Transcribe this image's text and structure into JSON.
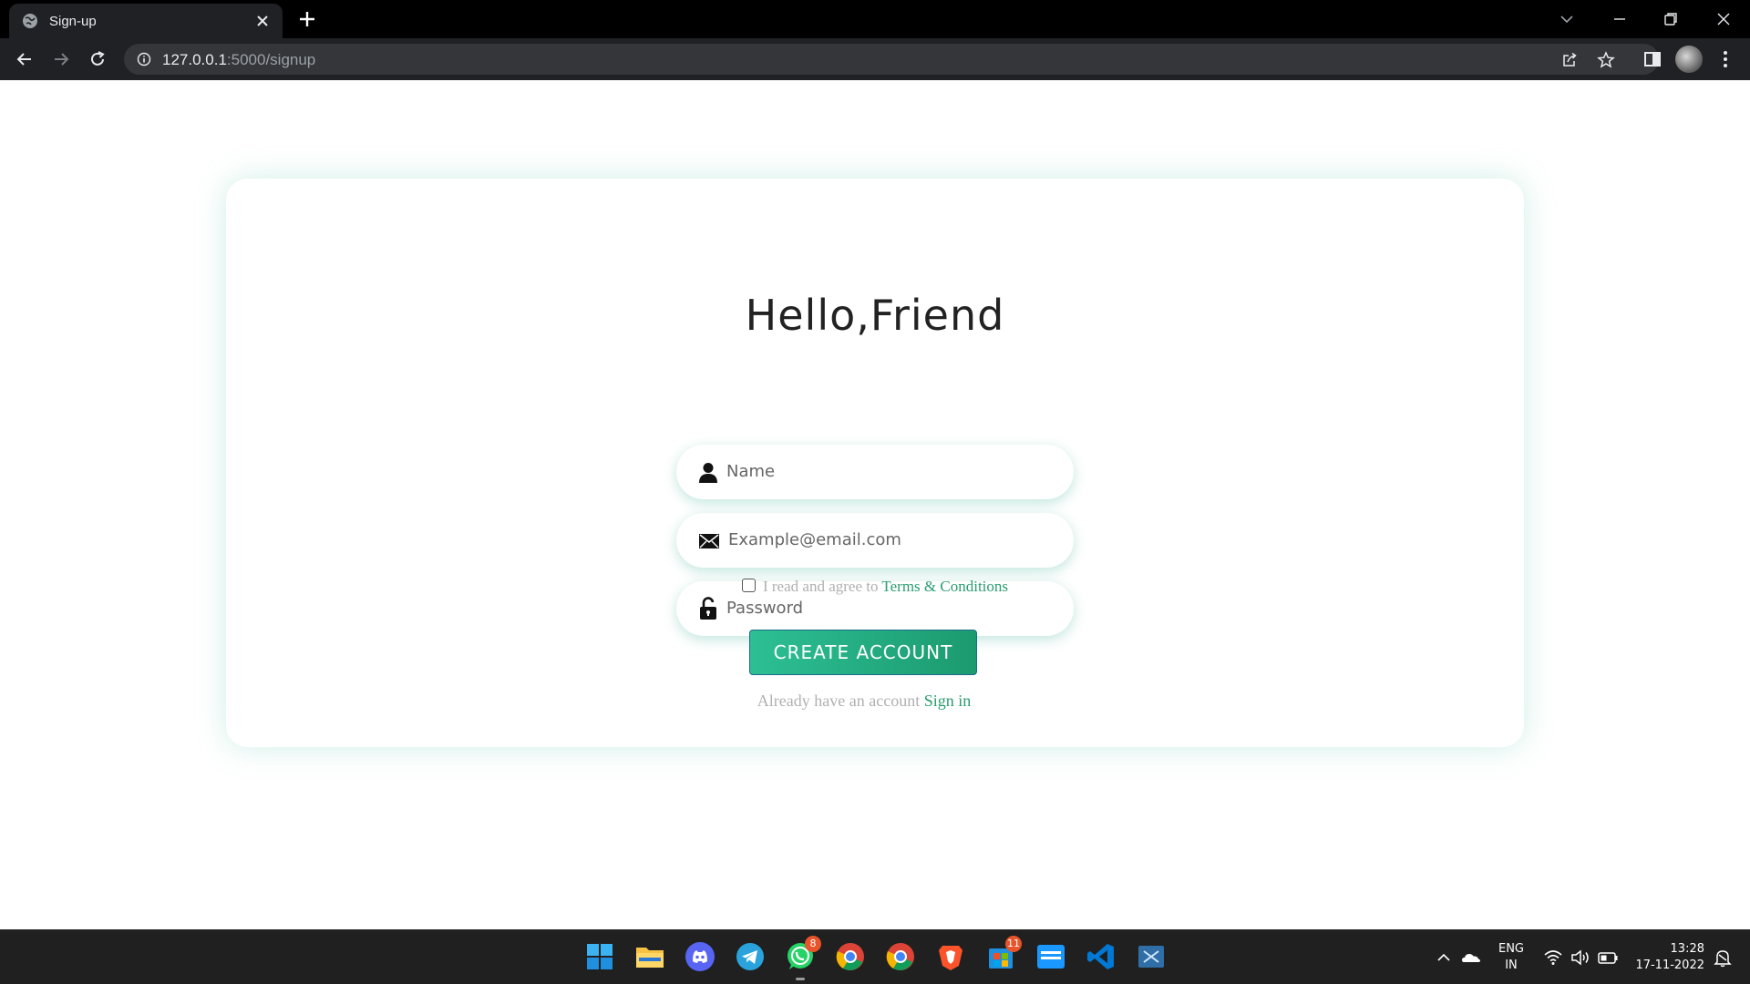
{
  "browser": {
    "tab": {
      "title": "Sign-up"
    },
    "address": {
      "host": "127.0.0.1",
      "path": ":5000/signup"
    }
  },
  "signup": {
    "heading": "Hello,Friend",
    "fields": {
      "name_placeholder": "Name",
      "email_placeholder": "Example@email.com",
      "password_placeholder": "Password"
    },
    "terms": {
      "prefix": "I read and agree to",
      "link": "Terms & Conditions",
      "checked": false
    },
    "create_button": "CREATE ACCOUNT",
    "signin": {
      "prefix": "Already have an account",
      "link": "Sign in"
    }
  },
  "taskbar": {
    "badges": {
      "whatsapp": "8",
      "store": "11"
    },
    "language": {
      "line1": "ENG",
      "line2": "IN"
    },
    "clock": {
      "time": "13:28",
      "date": "17-11-2022"
    }
  },
  "colors": {
    "accent_green": "#2a9d6f",
    "button_gradient_start": "#2dbf94",
    "button_gradient_end": "#1c9a6f",
    "chrome_dark": "#202124",
    "taskbar": "#202020",
    "badge": "#e8542b"
  },
  "icons": {
    "name_field": "user-icon",
    "email_field": "envelope-icon",
    "password_field": "unlock-icon",
    "omnibox": "info-icon"
  }
}
